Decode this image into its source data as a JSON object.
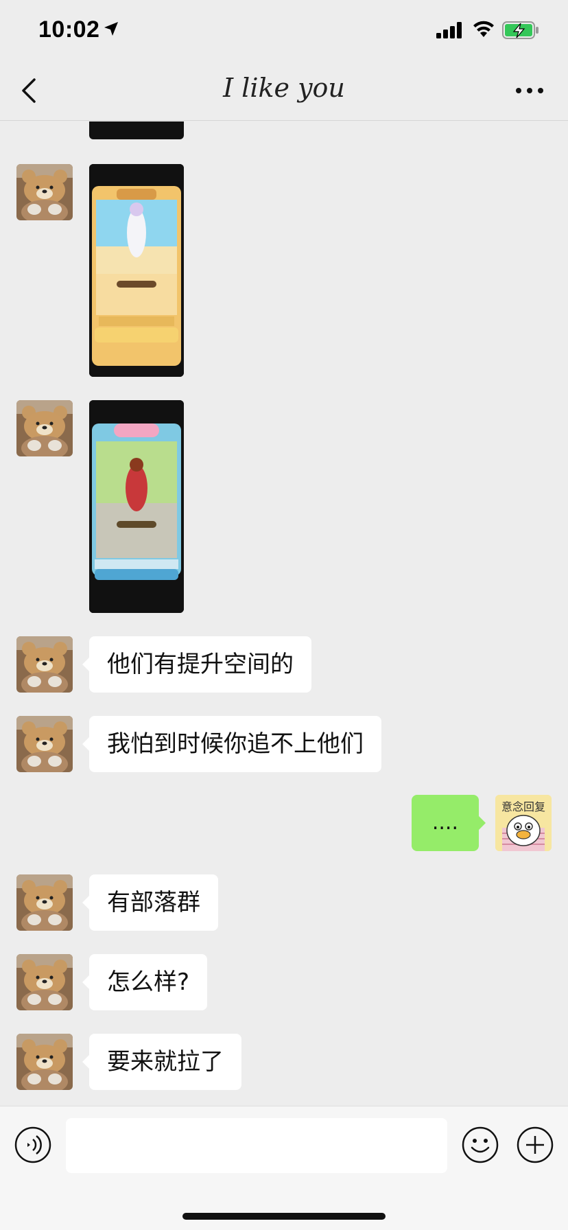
{
  "status_bar": {
    "time": "10:02",
    "icons": [
      "location-arrow-icon",
      "signal-icon",
      "wifi-icon",
      "battery-charging-icon"
    ]
  },
  "nav": {
    "title": "I like you",
    "back_icon": "chevron-left-icon",
    "more_icon": "more-dots-icon"
  },
  "messages": [
    {
      "sender": "other",
      "type": "image",
      "description": "game character screenshot (white outfit, beach)"
    },
    {
      "sender": "other",
      "type": "image",
      "description": "game character screenshot (red outfit, meadow)"
    },
    {
      "sender": "other",
      "type": "text",
      "text": "他们有提升空间的"
    },
    {
      "sender": "other",
      "type": "text",
      "text": "我怕到时候你追不上他们"
    },
    {
      "sender": "me",
      "type": "text",
      "text": "....",
      "sticker_avatar_text": "意念回复"
    },
    {
      "sender": "other",
      "type": "text",
      "text": "有部落群"
    },
    {
      "sender": "other",
      "type": "text",
      "text": "怎么样?"
    },
    {
      "sender": "other",
      "type": "text",
      "text": "要来就拉了"
    }
  ],
  "input_bar": {
    "placeholder": "",
    "icons": [
      "voice-icon",
      "emoji-icon",
      "plus-icon"
    ]
  },
  "colors": {
    "background": "#ededed",
    "my_bubble": "#95ec69",
    "other_bubble": "#ffffff",
    "battery": "#34c759"
  }
}
